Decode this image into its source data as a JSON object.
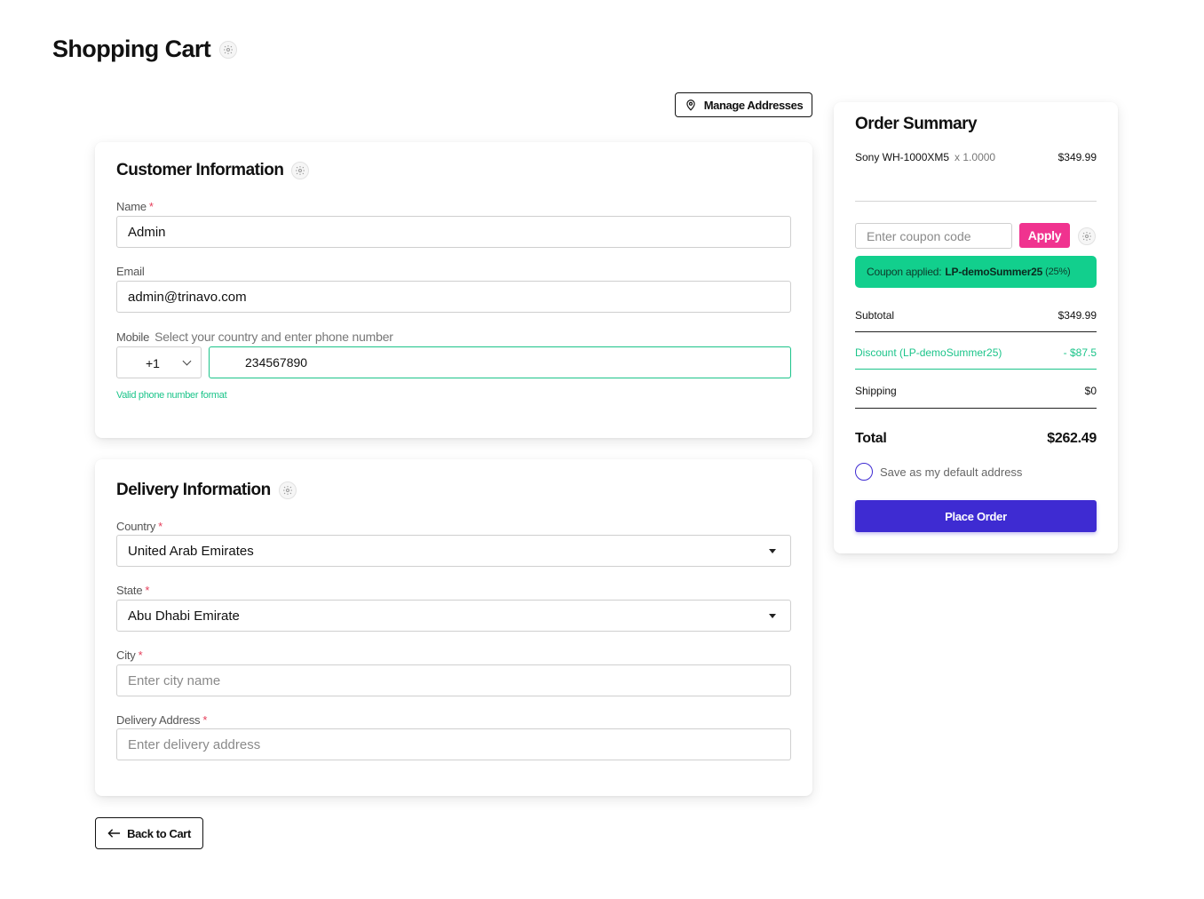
{
  "page": {
    "title": "Shopping Cart"
  },
  "header": {
    "manage_addresses_label": "Manage Addresses"
  },
  "customer": {
    "title": "Customer Information",
    "name": {
      "label": "Name",
      "required_mark": "*",
      "value": "Admin"
    },
    "email": {
      "label": "Email",
      "value": "admin@trinavo.com"
    },
    "mobile": {
      "label": "Mobile",
      "hint": "Select your country and enter phone number",
      "dial_code": "+1",
      "number": "234567890",
      "validation": "Valid phone number format"
    }
  },
  "delivery": {
    "title": "Delivery Information",
    "country": {
      "label": "Country",
      "required_mark": "*",
      "value": "United Arab Emirates"
    },
    "state": {
      "label": "State",
      "required_mark": "*",
      "value": "Abu Dhabi Emirate"
    },
    "city": {
      "label": "City",
      "required_mark": "*",
      "placeholder": "Enter city name"
    },
    "address": {
      "label": "Delivery Address",
      "required_mark": "*",
      "placeholder": "Enter delivery address"
    }
  },
  "back_label": "Back to Cart",
  "summary": {
    "title": "Order Summary",
    "item": {
      "name": "Sony WH-1000XM5",
      "qty": "x 1.0000",
      "price": "$349.99"
    },
    "coupon": {
      "placeholder": "Enter coupon code",
      "apply_label": "Apply",
      "applied_prefix": "Coupon applied:",
      "applied_code": "LP-demoSummer25",
      "applied_pct": "(25%)"
    },
    "subtotal": {
      "label": "Subtotal",
      "value": "$349.99"
    },
    "discount": {
      "label": "Discount (LP-demoSummer25)",
      "value": "- $87.5"
    },
    "shipping": {
      "label": "Shipping",
      "value": "$0"
    },
    "total": {
      "label": "Total",
      "value": "$262.49"
    },
    "default_address_label": "Save as my default address",
    "place_order_label": "Place Order"
  },
  "colors": {
    "accent": "#3e2bd2",
    "pink": "#f0338f",
    "green": "#12cf8d",
    "valid": "#1cc48a"
  }
}
